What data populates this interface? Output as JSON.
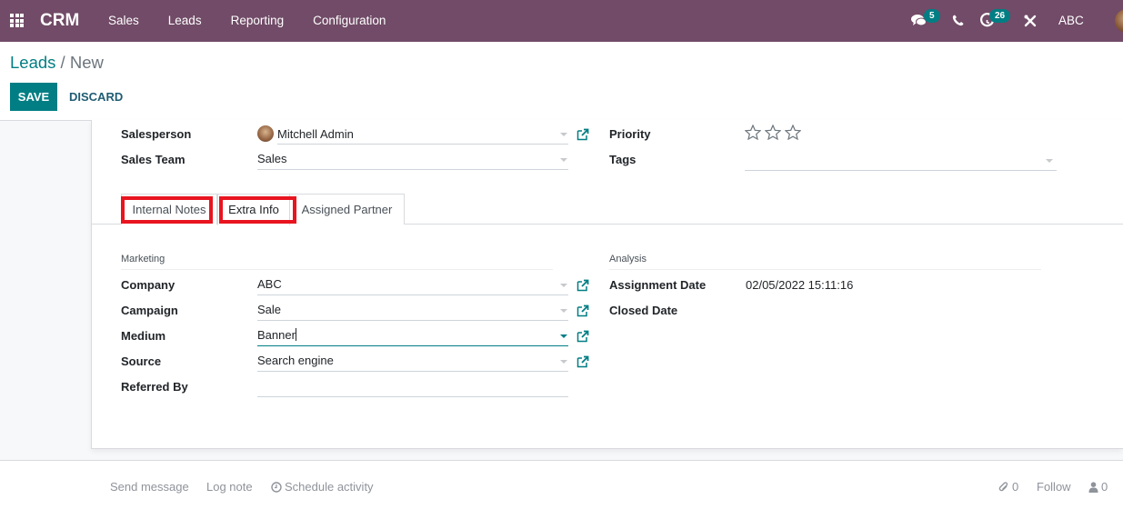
{
  "navbar": {
    "brand": "CRM",
    "menu": [
      {
        "label": "Sales"
      },
      {
        "label": "Leads"
      },
      {
        "label": "Reporting"
      },
      {
        "label": "Configuration"
      }
    ],
    "messages_count": "5",
    "activities_count": "26",
    "company": "ABC",
    "icons": {
      "apps": "apps-grid-icon",
      "messages": "chat-bubbles-icon",
      "phone": "phone-icon",
      "activities": "clock-icon",
      "debug": "tools-icon"
    }
  },
  "breadcrumb": {
    "parent": "Leads",
    "separator": " / ",
    "current": "New"
  },
  "toolbar": {
    "save_label": "SAVE",
    "discard_label": "DISCARD"
  },
  "form": {
    "salesperson": {
      "label": "Salesperson",
      "value": "Mitchell Admin"
    },
    "sales_team": {
      "label": "Sales Team",
      "value": "Sales"
    },
    "priority": {
      "label": "Priority",
      "stars_total": 3,
      "stars_filled": 0
    },
    "tags": {
      "label": "Tags",
      "value": ""
    }
  },
  "tabs": [
    {
      "label": "Internal Notes",
      "highlighted": true,
      "active": false
    },
    {
      "label": "Extra Info",
      "highlighted": true,
      "active": true
    },
    {
      "label": "Assigned Partner",
      "highlighted": false,
      "active": false
    }
  ],
  "extra_info": {
    "marketing": {
      "title": "Marketing",
      "company": {
        "label": "Company",
        "value": "ABC"
      },
      "campaign": {
        "label": "Campaign",
        "value": "Sale"
      },
      "medium": {
        "label": "Medium",
        "value": "Banner"
      },
      "source": {
        "label": "Source",
        "value": "Search engine"
      },
      "referred_by": {
        "label": "Referred By",
        "value": ""
      }
    },
    "analysis": {
      "title": "Analysis",
      "assignment_date": {
        "label": "Assignment Date",
        "value": "02/05/2022 15:11:16"
      },
      "closed_date": {
        "label": "Closed Date",
        "value": ""
      }
    }
  },
  "chatter": {
    "send_message": "Send message",
    "log_note": "Log note",
    "schedule_activity": "Schedule activity",
    "attachments_count": "0",
    "follow": "Follow",
    "followers_count": "0"
  },
  "colors": {
    "navbar": "#714b67",
    "primary": "#017e84",
    "highlight": "#e8141f"
  }
}
